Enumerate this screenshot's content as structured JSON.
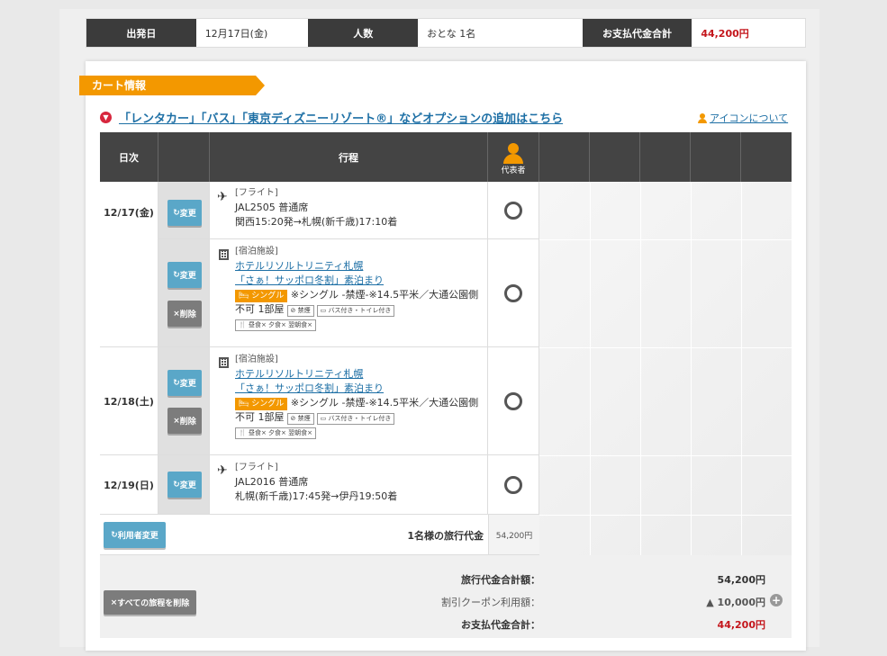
{
  "summary": {
    "departure_label": "出発日",
    "departure_value": "12月17日(金)",
    "people_label": "人数",
    "people_value": "おとな 1名",
    "total_label": "お支払代金合計",
    "total_value": "44,200円"
  },
  "cart": {
    "title": "カート情報",
    "option_link": "「レンタカー」「バス」「東京ディズニーリゾート®」などオプションの追加はこちら",
    "icon_about": "アイコンについて"
  },
  "table": {
    "col_date": "日次",
    "col_itinerary": "行程",
    "col_rep": "代表者",
    "rows": [
      {
        "date": "12/17(金)",
        "category": "[フライト]",
        "line1": "JAL2505 普通席",
        "line2": "関西15:20発→札幌(新千歳)17:10着",
        "change": "変更"
      },
      {
        "category": "[宿泊施設]",
        "hotel": "ホテルリソルトリニティ札幌",
        "plan": "「さぁ！サッポロ冬割」素泊まり",
        "room_tag": "シングル",
        "room_desc": "※シングル -禁煙-※14.5平米／大通公園側",
        "count": "不可 1部屋",
        "tag_smoke": "禁煙",
        "tag_bath": "バス付き・トイレ付き",
        "tag_meal": "昼食× 夕食× 翌朝食×",
        "change": "変更",
        "delete": "削除"
      },
      {
        "date": "12/18(土)",
        "category": "[宿泊施設]",
        "hotel": "ホテルリソルトリニティ札幌",
        "plan": "「さぁ！サッポロ冬割」素泊まり",
        "room_tag": "シングル",
        "room_desc": "※シングル -禁煙-※14.5平米／大通公園側",
        "count": "不可 1部屋",
        "tag_smoke": "禁煙",
        "tag_bath": "バス付き・トイレ付き",
        "tag_meal": "昼食× 夕食× 翌朝食×",
        "change": "変更",
        "delete": "削除"
      },
      {
        "date": "12/19(日)",
        "category": "[フライト]",
        "line1": "JAL2016 普通席",
        "line2": "札幌(新千歳)17:45発→伊丹19:50着",
        "change": "変更"
      }
    ],
    "user_change": "利用者変更",
    "per_person_label": "1名様の旅行代金",
    "per_person_value": "54,200円"
  },
  "totals": {
    "delete_all": "すべての旅程を削除",
    "travel_total_label": "旅行代金合計額：",
    "travel_total_value": "54,200円",
    "coupon_label": "割引クーポン利用額：",
    "coupon_value": "▲ 10,000円",
    "pay_total_label": "お支払代金合計：",
    "pay_total_value": "44,200円"
  }
}
